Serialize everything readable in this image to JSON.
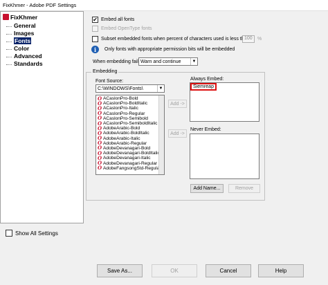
{
  "window": {
    "title": "FixKhmer - Adobe PDF Settings"
  },
  "tree": {
    "root": "FixKhmer",
    "items": [
      "General",
      "Images",
      "Fonts",
      "Color",
      "Advanced",
      "Standards"
    ]
  },
  "fonts": {
    "embed_all": "Embed all fonts",
    "embed_opentype": "Embed OpenType fonts",
    "subset": "Subset embedded fonts when percent of characters used is less than:",
    "subset_value": "100",
    "subset_unit": "%",
    "info": "Only fonts with appropriate permission bits will be embedded",
    "embed_fails_label": "When embedding fails:",
    "embed_fails_value": "Warn and continue"
  },
  "embedding": {
    "title": "Embedding",
    "font_source_label": "Font Source:",
    "font_source_value": "C:\\WINDOWS\\Fonts\\",
    "font_list": [
      "ACaslonPro-Bold",
      "ACaslonPro-BoldItalic",
      "ACaslonPro-Italic",
      "ACaslonPro-Regular",
      "ACaslonPro-Semibold",
      "ACaslonPro-SemiboldItalic",
      "AdobeArabic-Bold",
      "AdobeArabic-BoldItalic",
      "AdobeArabic-Italic",
      "AdobeArabic-Regular",
      "AdobeDevanagari-Bold",
      "AdobeDevanagari-BoldItalic",
      "AdobeDevanagari-Italic",
      "AdobeDevanagari-Regular",
      "AdobeFangsongStd-Regular"
    ],
    "add_label": "Add ->",
    "always_embed_label": "Always Embed:",
    "always_embed_items": [
      "Siemreap"
    ],
    "never_embed_label": "Never Embed:",
    "add_name_label": "Add Name...",
    "remove_label": "Remove"
  },
  "footer": {
    "show_all": "Show All Settings",
    "save_as": "Save As...",
    "ok": "OK",
    "cancel": "Cancel",
    "help": "Help"
  },
  "colors": {
    "selection": "#0a246a",
    "highlight": "#dd1111",
    "accent": "#c8102e"
  }
}
